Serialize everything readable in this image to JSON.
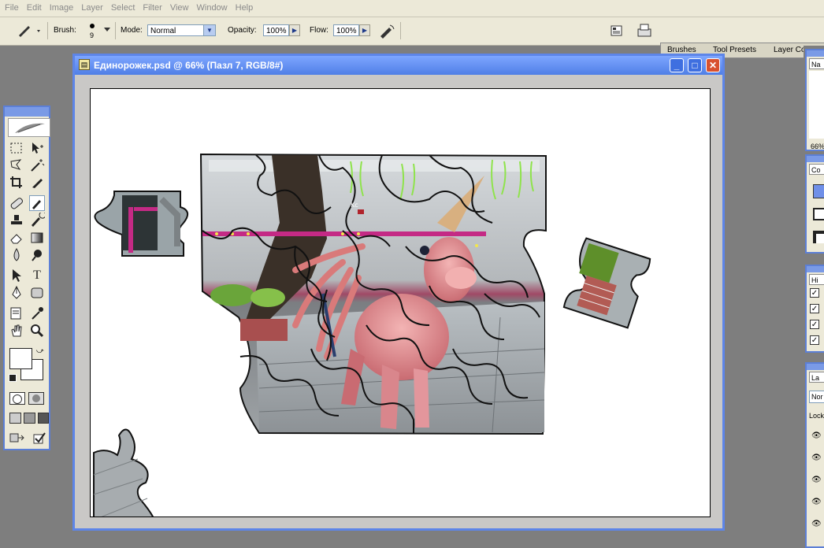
{
  "menu": [
    "File",
    "Edit",
    "Image",
    "Layer",
    "Select",
    "Filter",
    "View",
    "Window",
    "Help"
  ],
  "options": {
    "brush_label": "Brush:",
    "brush_size": "9",
    "mode_label": "Mode:",
    "mode_value": "Normal",
    "opacity_label": "Opacity:",
    "opacity_value": "100%",
    "flow_label": "Flow:",
    "flow_value": "100%"
  },
  "palette_tabs": [
    "Brushes",
    "Tool Presets",
    "Layer Comps"
  ],
  "document": {
    "title": "Единорожек.psd @ 66% (Пазл 7, RGB/8#)"
  },
  "toolbox": {
    "tools": [
      "marquee-tool",
      "move-tool",
      "lasso-tool",
      "magic-wand-tool",
      "crop-tool",
      "slice-tool",
      "healing-brush-tool",
      "brush-tool",
      "clone-stamp-tool",
      "history-brush-tool",
      "eraser-tool",
      "gradient-tool",
      "blur-tool",
      "dodge-tool",
      "path-selection-tool",
      "type-tool",
      "pen-tool",
      "shape-tool",
      "notes-tool",
      "eyedropper-tool",
      "hand-tool",
      "zoom-tool"
    ],
    "type_glyph": "T"
  },
  "right_panels": {
    "navigator_tab": "Na",
    "zoom": "66%",
    "color_tab": "Co",
    "history_tab": "Hi",
    "layers_tab": "La",
    "blend_mode": "Nor",
    "lock_label": "Lock"
  },
  "colors": {
    "title_bar": "#4f7fe6",
    "accent": "#5d85e8",
    "ui_bg": "#ece9d8"
  }
}
